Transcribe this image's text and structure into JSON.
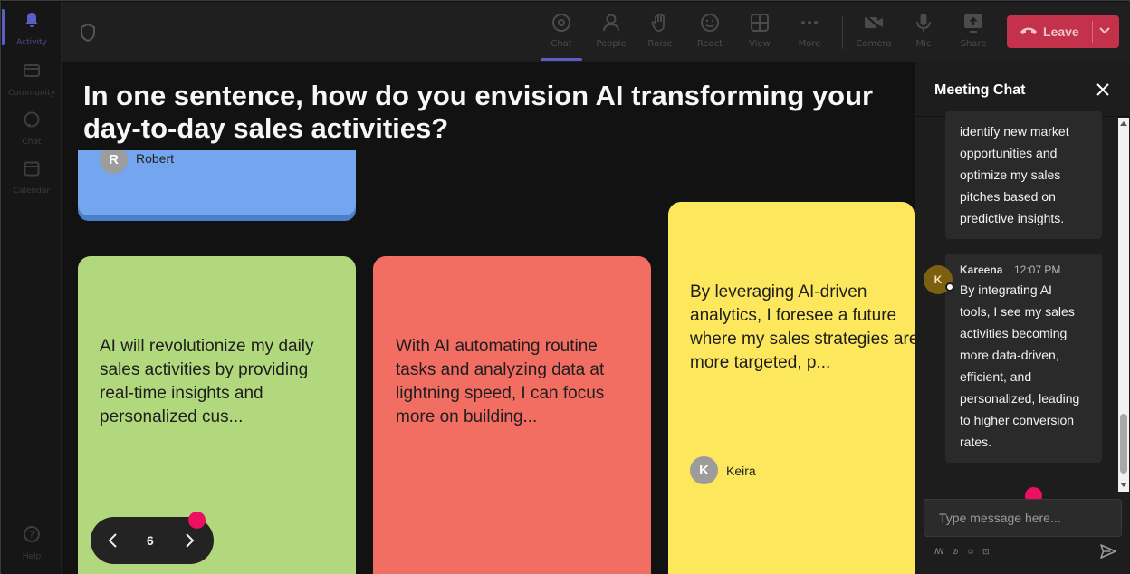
{
  "rail": {
    "items": [
      {
        "label": "Activity",
        "icon": "bell-icon",
        "active": true
      },
      {
        "label": "Community",
        "icon": "community-icon"
      },
      {
        "label": "Chat",
        "icon": "chat-icon"
      },
      {
        "label": "Calendar",
        "icon": "calendar-icon"
      },
      {
        "label": "Help",
        "icon": "help-icon"
      }
    ]
  },
  "toolbar": {
    "buttons": [
      {
        "label": "Chat",
        "icon": "chat-icon",
        "active": true
      },
      {
        "label": "People",
        "icon": "people-icon"
      },
      {
        "label": "Raise",
        "icon": "raise-hand-icon"
      },
      {
        "label": "React",
        "icon": "react-icon"
      },
      {
        "label": "View",
        "icon": "view-grid-icon"
      },
      {
        "label": "More",
        "icon": "more-icon"
      },
      {
        "label": "Camera",
        "icon": "camera-off-icon"
      },
      {
        "label": "Mic",
        "icon": "mic-icon"
      },
      {
        "label": "Share",
        "icon": "share-icon"
      }
    ],
    "leave_label": "Leave",
    "leave_color": "#c4314b"
  },
  "stage": {
    "question": "In one sentence, how do you envision AI transforming your day-to-day sales activities?",
    "cards": [
      {
        "author_initial": "R",
        "author": "Robert",
        "color": "#73a6ee"
      },
      {
        "text": "AI will revolutionize my daily sales activities by providing real-time insights and personalized cus...",
        "color": "#b1d87c"
      },
      {
        "text": "With AI automating routine tasks and analyzing data at lightning speed, I can focus more on building...",
        "color": "#f26d62"
      },
      {
        "text": "By leveraging AI-driven analytics, I foresee a future where my sales strategies are more targeted, p...",
        "author_initial": "K",
        "author": "Keira",
        "color": "#fde85d"
      }
    ],
    "page": "6"
  },
  "chat": {
    "title": "Meeting Chat",
    "messages": [
      {
        "lines": [
          "identify new market",
          "opportunities and",
          "optimize my sales",
          "pitches based on",
          "predictive insights."
        ]
      },
      {
        "author": "Kareena",
        "initial": "K",
        "time": "12:07 PM",
        "lines": [
          "By integrating AI",
          "tools, I see my sales",
          "activities becoming",
          "more data-driven,",
          "efficient, and",
          "personalized, leading",
          "to higher conversion",
          "rates."
        ]
      }
    ],
    "input_placeholder": "Type message here...",
    "format_tools": "ꟿ ⊘ ☺ ⊡"
  },
  "accent_color": "#5a5fc4",
  "indicator_color": "#ec0f62"
}
